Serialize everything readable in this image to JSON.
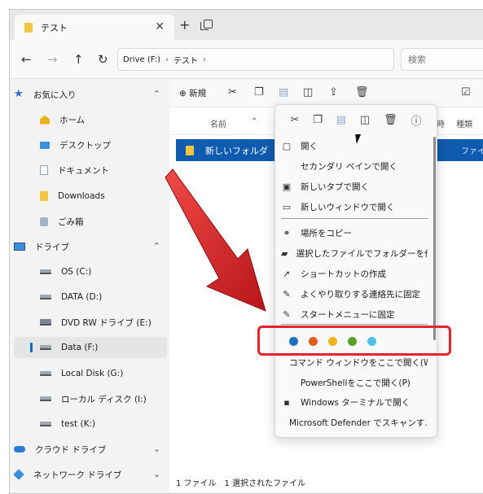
{
  "tab": {
    "title": "テスト",
    "close": "✕",
    "add": "+"
  },
  "nav": {
    "back": "←",
    "forward": "→",
    "up": "↑",
    "refresh": "↻"
  },
  "address": {
    "segments": [
      "Drive (F:)",
      "テスト"
    ],
    "separator": "›"
  },
  "search": {
    "placeholder": "検索"
  },
  "sidebar": {
    "items": [
      {
        "label": "お気に入り",
        "icon": "star-icon",
        "chevron": "⌃"
      },
      {
        "label": "ホーム",
        "icon": "home-icon"
      },
      {
        "label": "デスクトップ",
        "icon": "desktop-icon"
      },
      {
        "label": "ドキュメント",
        "icon": "document-icon"
      },
      {
        "label": "Downloads",
        "icon": "folder-icon"
      },
      {
        "label": "ごみ箱",
        "icon": "recycle-bin-icon"
      },
      {
        "label": "ドライブ",
        "icon": "pc-icon",
        "chevron": "⌃"
      },
      {
        "label": "OS (C:)",
        "icon": "drive-icon"
      },
      {
        "label": "DATA (D:)",
        "icon": "drive-icon"
      },
      {
        "label": "DVD RW ドライブ (E:)",
        "icon": "dvd-drive-icon"
      },
      {
        "label": "Data (F:)",
        "icon": "drive-icon",
        "selected": true
      },
      {
        "label": "Local Disk (G:)",
        "icon": "drive-icon"
      },
      {
        "label": "ローカル ディスク (I:)",
        "icon": "drive-icon"
      },
      {
        "label": "test (K:)",
        "icon": "drive-icon"
      },
      {
        "label": "クラウド ドライブ",
        "icon": "cloud-icon",
        "chevron": "⌄"
      },
      {
        "label": "ネットワーク ドライブ",
        "icon": "network-icon",
        "chevron": "⌄"
      }
    ]
  },
  "toolbar": {
    "new_label": "新規",
    "new_icon": "⊕"
  },
  "columns": {
    "name": "名前",
    "sort": "⌃",
    "date": "時",
    "type": "種類"
  },
  "file": {
    "name": "新しいフォルダ",
    "type": "ファイル"
  },
  "status": {
    "count": "1 ファイル",
    "selected": "1 選択されたファイル"
  },
  "menu": {
    "items": [
      {
        "label": "開く",
        "icon": "open-icon",
        "glyph": "▢"
      },
      {
        "label": "セカンダリ ペインで開く",
        "icon": "",
        "glyph": ""
      },
      {
        "label": "新しいタブで開く",
        "icon": "new-tab-icon",
        "glyph": "▣"
      },
      {
        "label": "新しいウィンドウで開く",
        "icon": "new-window-icon",
        "glyph": "▭"
      },
      {
        "label": "場所をコピー",
        "icon": "link-icon",
        "glyph": "⚭"
      },
      {
        "label": "選択したファイルでフォルダーを作成",
        "icon": "folder-add-icon",
        "glyph": "▰"
      },
      {
        "label": "ショートカットの作成",
        "icon": "shortcut-icon",
        "glyph": "➚"
      },
      {
        "label": "よくやり取りする連絡先に固定",
        "icon": "pin-icon",
        "glyph": "✎"
      },
      {
        "label": "スタートメニューに固定",
        "icon": "pin-icon",
        "glyph": "✎"
      },
      {
        "label": "コマンド ウィンドウをここで開く(W)",
        "icon": "",
        "glyph": ""
      },
      {
        "label": "PowerShellをここで開く(P)",
        "icon": "",
        "glyph": ""
      },
      {
        "label": "Windows ターミナルで開く",
        "icon": "terminal-icon",
        "glyph": "▪"
      },
      {
        "label": "Microsoft Defender でスキャンす...",
        "icon": "",
        "glyph": ""
      }
    ],
    "color_tags": [
      "#1f6fc0",
      "#e25a1c",
      "#efb21a",
      "#5aa02c",
      "#4ec0e8"
    ]
  },
  "colors": {
    "accent": "#0e5bb0",
    "annotation": "#e8222b"
  }
}
